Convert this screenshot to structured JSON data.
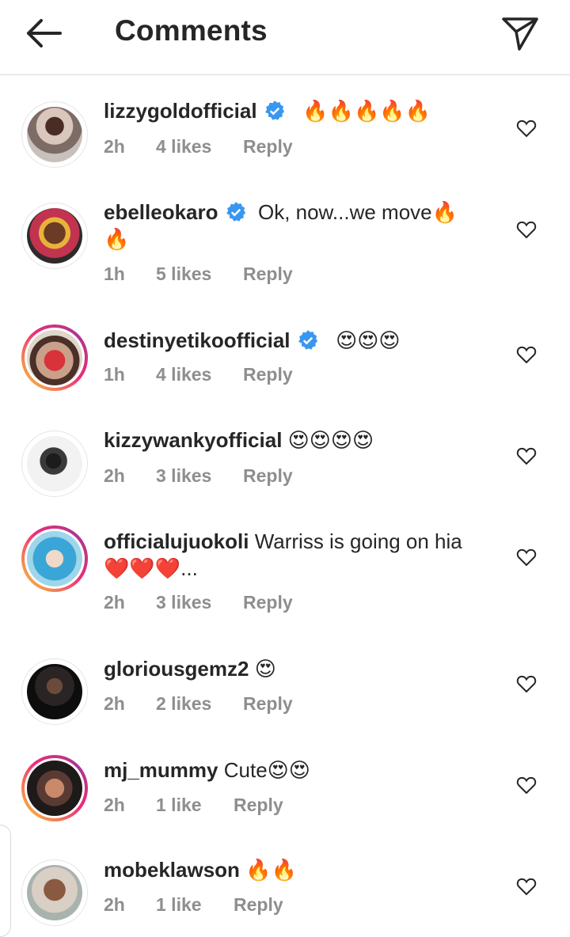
{
  "header": {
    "title": "Comments"
  },
  "comments": [
    {
      "username": "lizzygoldofficial",
      "verified": true,
      "text": "🔥🔥🔥🔥🔥",
      "time": "2h",
      "likes": "4 likes",
      "reply": "Reply"
    },
    {
      "username": "ebelleokaro",
      "verified": true,
      "text": "Ok, now...we move🔥🔥",
      "time": "1h",
      "likes": "5 likes",
      "reply": "Reply"
    },
    {
      "username": "destinyetikoofficial",
      "verified": true,
      "text": "😍😍😍",
      "time": "1h",
      "likes": "4 likes",
      "reply": "Reply"
    },
    {
      "username": "kizzywankyofficial",
      "verified": false,
      "text": "😍😍😍😍",
      "time": "2h",
      "likes": "3 likes",
      "reply": "Reply"
    },
    {
      "username": "officialujuokoli",
      "verified": false,
      "text": "Warriss is going on hia ❤️❤️❤️...",
      "time": "2h",
      "likes": "3 likes",
      "reply": "Reply"
    },
    {
      "username": "gloriousgemz2",
      "verified": false,
      "text": "😍",
      "time": "2h",
      "likes": "2 likes",
      "reply": "Reply"
    },
    {
      "username": "mj_mummy",
      "verified": false,
      "text": "Cute😍😍",
      "time": "2h",
      "likes": "1 like",
      "reply": "Reply"
    },
    {
      "username": "mobeklawson",
      "verified": false,
      "text": "🔥🔥",
      "time": "2h",
      "likes": "1 like",
      "reply": "Reply"
    }
  ]
}
